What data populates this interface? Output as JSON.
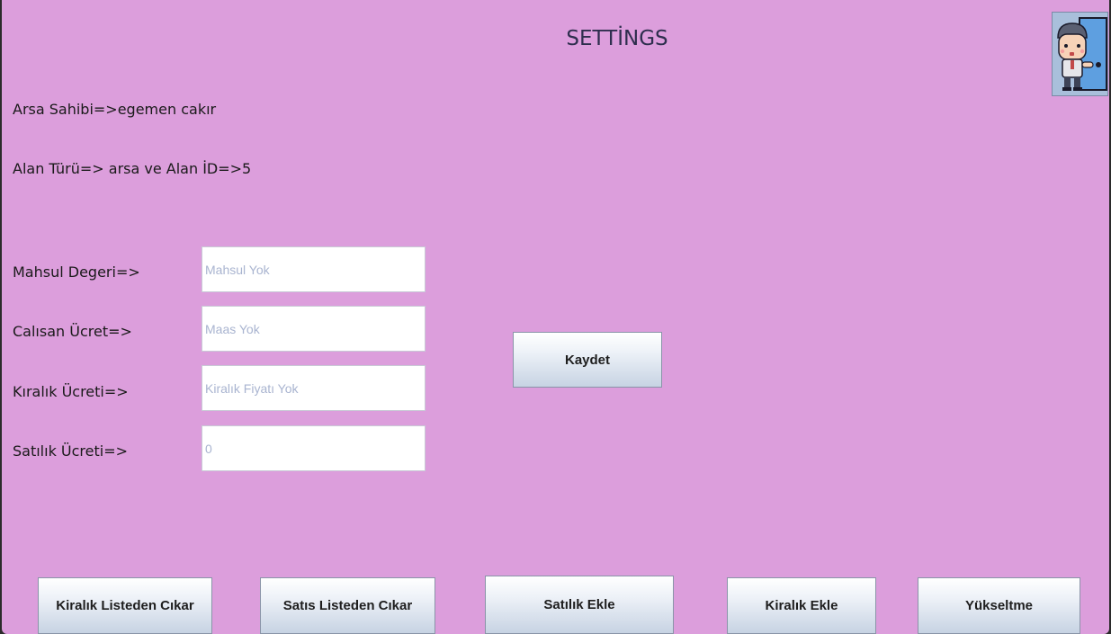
{
  "title": "SETTİNGS",
  "info": {
    "owner": "Arsa Sahibi=>egemen cakır",
    "area": "Alan Türü=> arsa ve Alan İD=>5"
  },
  "form": {
    "crop": {
      "label": "Mahsul Degeri=>",
      "placeholder": "Mahsul Yok"
    },
    "worker": {
      "label": "Calısan Ücret=>",
      "placeholder": "Maas Yok"
    },
    "rent": {
      "label": "Kıralık Ücreti=>",
      "placeholder": "Kiralık Fiyatı Yok"
    },
    "sale": {
      "label": "Satılık Ücreti=>",
      "placeholder": "0"
    }
  },
  "buttons": {
    "save": "Kaydet",
    "remove_rent": "Kiralık Listeden Cıkar",
    "remove_sale": "Satıs Listeden Cıkar",
    "add_sale": "Satılık Ekle",
    "add_rent": "Kiralık Ekle",
    "upgrade": "Yükseltme"
  },
  "icons": {
    "avatar": "user-exit-door-icon"
  },
  "colors": {
    "background": "#dc9edc",
    "title": "#2e2e4e"
  }
}
